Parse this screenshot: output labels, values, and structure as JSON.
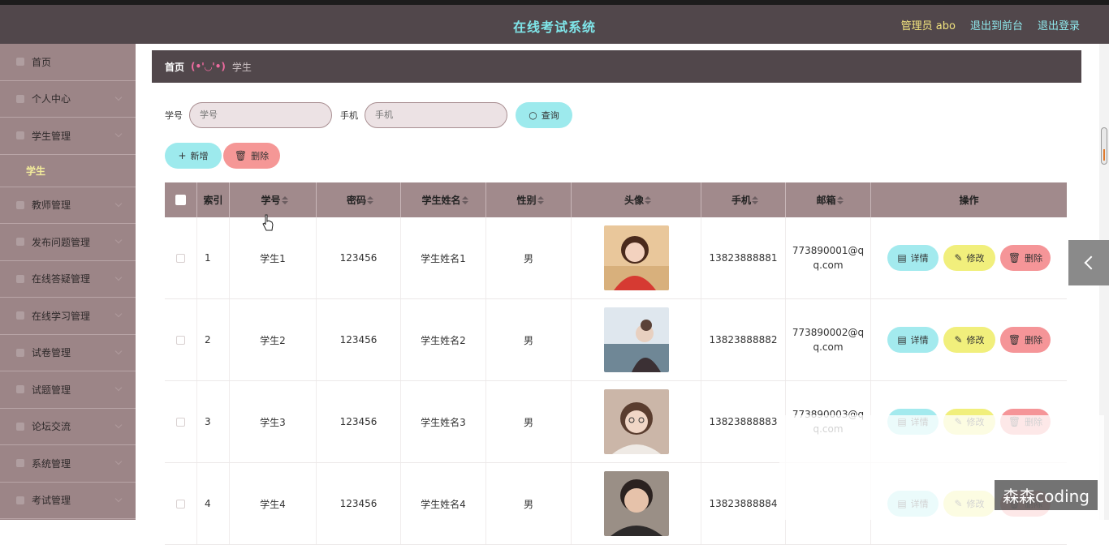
{
  "header": {
    "title": "在线考试系统",
    "admin_label": "管理员 abo",
    "front_link": "退出到前台",
    "logout_link": "退出登录"
  },
  "sidebar": {
    "items": [
      {
        "label": "首页",
        "icon": "home-icon",
        "expandable": false
      },
      {
        "label": "个人中心",
        "icon": "user-icon",
        "expandable": true
      },
      {
        "label": "学生管理",
        "icon": "user-icon",
        "expandable": true
      },
      {
        "label": "教师管理",
        "icon": "send-icon",
        "expandable": true
      },
      {
        "label": "发布问题管理",
        "icon": "list-icon",
        "expandable": true
      },
      {
        "label": "在线答疑管理",
        "icon": "grid-icon",
        "expandable": true
      },
      {
        "label": "在线学习管理",
        "icon": "doc-icon",
        "expandable": true
      },
      {
        "label": "试卷管理",
        "icon": "frame-icon",
        "expandable": true
      },
      {
        "label": "试题管理",
        "icon": "ticket-icon",
        "expandable": true
      },
      {
        "label": "论坛交流",
        "icon": "list-icon",
        "expandable": true
      },
      {
        "label": "系统管理",
        "icon": "square-icon",
        "expandable": true
      },
      {
        "label": "考试管理",
        "icon": "list-icon",
        "expandable": true
      }
    ],
    "active_sub": "学生"
  },
  "breadcrumb": {
    "home": "首页",
    "separator": "(•'◡'•)",
    "current": "学生"
  },
  "search": {
    "student_id_label": "学号",
    "student_id_placeholder": "学号",
    "phone_label": "手机",
    "phone_placeholder": "手机",
    "query_button": "查询"
  },
  "actions": {
    "add_button": "新增",
    "delete_button": "删除"
  },
  "table": {
    "columns": [
      "索引",
      "学号",
      "密码",
      "学生姓名",
      "性别",
      "头像",
      "手机",
      "邮箱",
      "操作"
    ],
    "rows": [
      {
        "index": "1",
        "student_id": "学生1",
        "password": "123456",
        "name": "学生姓名1",
        "gender": "男",
        "phone": "13823888881",
        "email": "773890001@qq.com"
      },
      {
        "index": "2",
        "student_id": "学生2",
        "password": "123456",
        "name": "学生姓名2",
        "gender": "男",
        "phone": "13823888882",
        "email": "773890002@qq.com"
      },
      {
        "index": "3",
        "student_id": "学生3",
        "password": "123456",
        "name": "学生姓名3",
        "gender": "男",
        "phone": "13823888883",
        "email": "773890003@qq.com"
      },
      {
        "index": "4",
        "student_id": "学生4",
        "password": "123456",
        "name": "学生姓名4",
        "gender": "男",
        "phone": "13823888884",
        "email": ""
      }
    ],
    "row_actions": {
      "detail": "详情",
      "edit": "修改",
      "remove": "删除"
    }
  },
  "watermark": "森森coding",
  "colors": {
    "topbar": "#51474b",
    "sidebar": "#9c8587",
    "accent_cyan": "#9deaed",
    "accent_yellow": "#f1ef7c",
    "accent_red": "#f59796"
  }
}
